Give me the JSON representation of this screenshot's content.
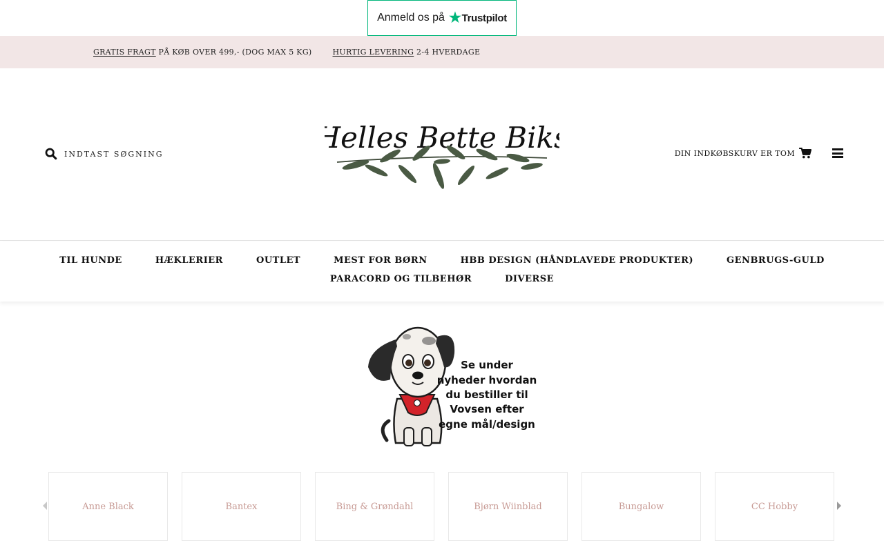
{
  "trustpilot": {
    "text": "Anmeld os på",
    "brand": "Trustpilot"
  },
  "promo": {
    "item1_highlight": "GRATIS FRAGT",
    "item1_rest": " PÅ KØB OVER 499,- (DOG MAX 5 KG)",
    "item2_highlight": "HURTIG LEVERING",
    "item2_rest": " 2-4 HVERDAGE"
  },
  "header": {
    "search_placeholder": "INDTAST SØGNING",
    "logo_text": "Helles Bette Biks",
    "cart_label": "DIN INDKØBSKURV ER TOM"
  },
  "nav": {
    "row1": [
      "TIL HUNDE",
      "HÆKLERIER",
      "OUTLET",
      "MEST FOR BØRN",
      "HBB DESIGN (HÅNDLAVEDE PRODUKTER)",
      "GENBRUGS-GULD"
    ],
    "row2": [
      "PARACORD OG TILBEHØR",
      "DIVERSE"
    ]
  },
  "banner": {
    "lines": [
      "Se under",
      "nyheder hvordan",
      "du bestiller til",
      "Vovsen efter",
      "egne mål/design"
    ]
  },
  "brands": [
    "Anne Black",
    "Bantex",
    "Bing & Grøndahl",
    "Bjørn Wiinblad",
    "Bungalow",
    "CC Hobby"
  ],
  "colors": {
    "trustpilot_green": "#00b67a",
    "promo_bg": "#f2e6e6",
    "brand_text": "#c79a94",
    "leaf": "#4a5a44",
    "bandana": "#d3232a"
  }
}
